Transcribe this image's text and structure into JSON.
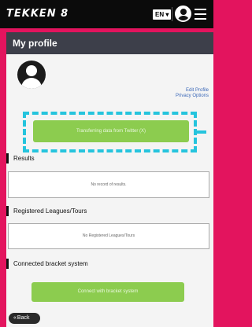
{
  "header": {
    "logo": "TEKKEN 8",
    "language": "EN ▾",
    "avatar_icon": "user-avatar-icon",
    "menu_icon": "hamburger-menu-icon"
  },
  "page": {
    "title": "My profile",
    "edit_profile": "Edit Profile",
    "privacy_options": "Privacy Options",
    "transfer_button": "Transferring data from Twitter (X)",
    "results": {
      "title": "Results",
      "empty": "No record of results."
    },
    "leagues": {
      "title": "Registered Leagues/Tours",
      "empty": "No Registered Leagues/Tours"
    },
    "bracket": {
      "title": "Connected bracket system",
      "button": "Connect with bracket system"
    },
    "back": "Back"
  },
  "colors": {
    "accent": "#e3145e",
    "title_bar": "#3d3f4a",
    "button_green": "#8ccc4f",
    "highlight_dashed": "#25c4dd",
    "link": "#3b68b8"
  }
}
